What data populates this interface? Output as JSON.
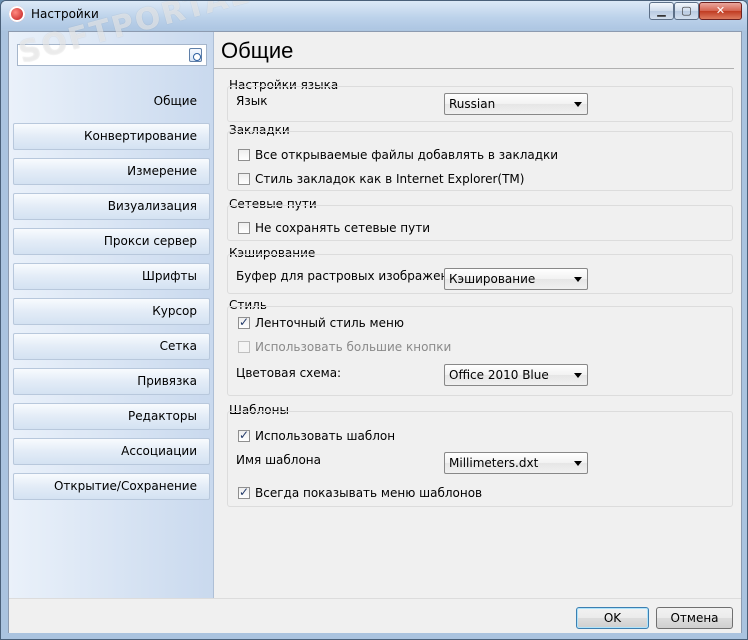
{
  "window": {
    "title": "Настройки"
  },
  "search": {
    "placeholder": ""
  },
  "sidebar": {
    "items": [
      {
        "label": "Общие"
      },
      {
        "label": "Конвертирование"
      },
      {
        "label": "Измерение"
      },
      {
        "label": "Визуализация"
      },
      {
        "label": "Прокси сервер"
      },
      {
        "label": "Шрифты"
      },
      {
        "label": "Курсор"
      },
      {
        "label": "Сетка"
      },
      {
        "label": "Привязка"
      },
      {
        "label": "Редакторы"
      },
      {
        "label": "Ассоциации"
      },
      {
        "label": "Открытие/Сохранение"
      }
    ]
  },
  "page": {
    "title": "Общие"
  },
  "language": {
    "group_title": "Настройки языка",
    "label": "Язык",
    "value": "Russian"
  },
  "bookmarks": {
    "group_title": "Закладки",
    "add_all_files": "Все открываемые файлы добавлять в закладки",
    "ie_style": "Стиль закладок как в Internet Explorer(TM)"
  },
  "network": {
    "group_title": "Сетевые пути",
    "dont_save": "Не сохранять сетевые пути"
  },
  "cache": {
    "group_title": "Кэширование",
    "label": "Буфер для растровых изображений:",
    "value": "Кэширование"
  },
  "style": {
    "group_title": "Стиль",
    "ribbon": "Ленточный стиль меню",
    "large_buttons": "Использовать большие кнопки",
    "color_scheme_label": "Цветовая схема:",
    "color_scheme_value": "Office 2010 Blue"
  },
  "templates": {
    "group_title": "Шаблоны",
    "use_template": "Использовать шаблон",
    "name_label": "Имя шаблона",
    "name_value": "Millimeters.dxt",
    "always_show_menu": "Всегда показывать меню шаблонов"
  },
  "footer": {
    "ok": "OK",
    "cancel": "Отмена"
  },
  "watermark": {
    "text": "SOFTPORTAL"
  },
  "colors": {
    "titlebar": "#bcd2ea",
    "sidebar": "#c9d9ee",
    "close_button": "#c03b22",
    "checkbox_mark": "#243b6a"
  }
}
